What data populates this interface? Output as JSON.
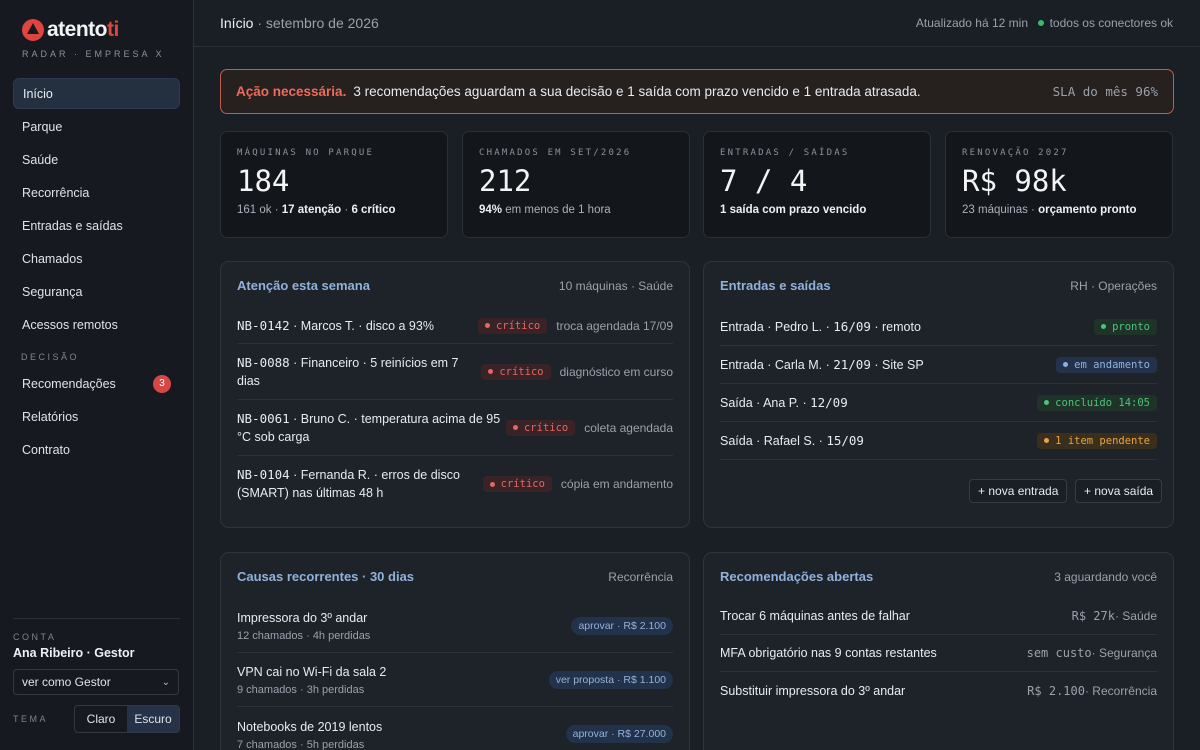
{
  "brand": {
    "logo_main": "atento",
    "logo_accent": "ti",
    "subtitle": "RADAR · EMPRESA X"
  },
  "sidebar": {
    "items": [
      {
        "label": "Início"
      },
      {
        "label": "Parque"
      },
      {
        "label": "Saúde"
      },
      {
        "label": "Recorrência"
      },
      {
        "label": "Entradas e saídas"
      },
      {
        "label": "Chamados"
      },
      {
        "label": "Segurança"
      },
      {
        "label": "Acessos remotos"
      }
    ],
    "section_label": "DECISÃO",
    "decision_items": [
      {
        "label": "Recomendações",
        "badge": "3"
      },
      {
        "label": "Relatórios"
      },
      {
        "label": "Contrato"
      }
    ],
    "account_label": "CONTA",
    "account_name": "Ana Ribeiro · Gestor",
    "view_as": "ver como Gestor",
    "theme_label": "TEMA",
    "theme_options": [
      "Claro",
      "Escuro"
    ]
  },
  "topbar": {
    "title": "Início",
    "period": "· setembro de 2026",
    "updated": "Atualizado há 12 min",
    "connectors": "todos os conectores ok"
  },
  "alert": {
    "title": "Ação necessária.",
    "text": "3 recomendações aguardam a sua decisão e 1 saída com prazo vencido e 1 entrada atrasada.",
    "sla": "SLA do mês 96%"
  },
  "kpis": [
    {
      "label": "MÁQUINAS NO PARQUE",
      "value": "184",
      "sub_a": "161 ok · ",
      "sub_b": "17 atenção",
      "sub_c": " · ",
      "sub_d": "6 crítico"
    },
    {
      "label": "CHAMADOS EM SET/2026",
      "value": "212",
      "sub_b": "94%",
      "sub_c": " em menos de 1 hora"
    },
    {
      "label": "ENTRADAS / SAÍDAS",
      "value": "7 / 4",
      "sub_b": "1 saída com prazo vencido"
    },
    {
      "label": "RENOVAÇÃO 2027",
      "value": "R$ 98k",
      "sub_a": "23 máquinas · ",
      "sub_b": "orçamento pronto"
    }
  ],
  "attention": {
    "title": "Atenção esta semana",
    "meta": "10 máquinas · Saúde",
    "rows": [
      {
        "id": "NB-0142",
        "text": " · Marcos T. · disco a 93%",
        "tag": "crítico",
        "status": "troca agendada 17/09"
      },
      {
        "id": "NB-0088",
        "text": " · Financeiro · 5 reinícios em 7 dias",
        "tag": "crítico",
        "status": "diagnóstico em curso"
      },
      {
        "id": "NB-0061",
        "text": " · Bruno C. · temperatura acima de 95 °C sob carga",
        "tag": "crítico",
        "status": "coleta agendada"
      },
      {
        "id": "NB-0104",
        "text": " · Fernanda R. · erros de disco (SMART) nas últimas 48 h",
        "tag": "crítico",
        "status": "cópia em andamento"
      }
    ]
  },
  "movements": {
    "title": "Entradas e saídas",
    "meta": "RH · Operações",
    "rows": [
      {
        "kind": "Entrada · Pedro L. · ",
        "date": "16/09",
        "rest": " · remoto",
        "tag": "pronto"
      },
      {
        "kind": "Entrada · Carla M. · ",
        "date": "21/09",
        "rest": " · Site SP",
        "tag": "em andamento"
      },
      {
        "kind": "Saída · Ana P. · ",
        "date": "12/09",
        "rest": "",
        "tag": "concluído 14:05"
      },
      {
        "kind": "Saída · Rafael S. · ",
        "date": "15/09",
        "rest": "",
        "tag": "1 item pendente"
      }
    ],
    "btn_new_entry": "+ nova entrada",
    "btn_new_exit": "+ nova saída"
  },
  "recurring": {
    "title": "Causas recorrentes · 30 dias",
    "meta": "Recorrência",
    "rows": [
      {
        "title": "Impressora do 3º andar",
        "sub": "12 chamados · 4h perdidas",
        "action": "aprovar · R$ 2.100"
      },
      {
        "title": "VPN cai no Wi-Fi da sala 2",
        "sub": "9 chamados · 3h perdidas",
        "action": "ver proposta · R$ 1.100"
      },
      {
        "title": "Notebooks de 2019 lentos",
        "sub": "7 chamados · 5h perdidas",
        "action": "aprovar · R$ 27.000"
      }
    ]
  },
  "recommendations": {
    "title": "Recomendações abertas",
    "meta": "3 aguardando você",
    "rows": [
      {
        "title": "Trocar 6 máquinas antes de falhar",
        "cost": "R$ 27k",
        "area": " · Saúde"
      },
      {
        "title": "MFA obrigatório nas 9 contas restantes",
        "cost": "sem custo",
        "area": " · Segurança"
      },
      {
        "title": "Substituir impressora do 3º andar",
        "cost": "R$ 2.100",
        "area": " · Recorrência"
      }
    ]
  },
  "colors": {
    "accent_red": "#e0443e",
    "title_blue": "#8fb2dc",
    "ok_green": "#3fb96d",
    "warn_amber": "#e6a443"
  }
}
